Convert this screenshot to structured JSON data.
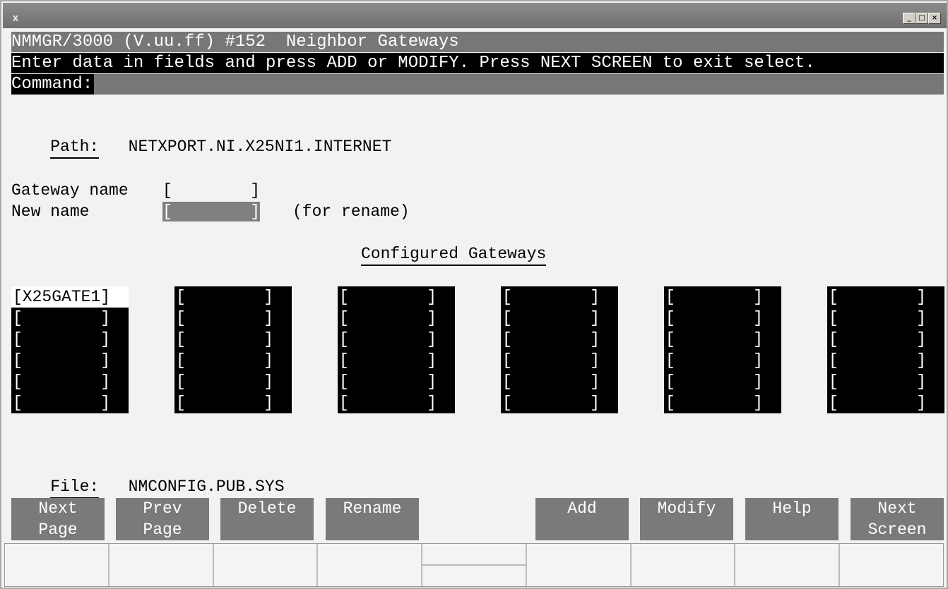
{
  "window": {
    "icon": "X",
    "buttons": [
      "_",
      "□",
      "×"
    ]
  },
  "header": {
    "title": "NMMGR/3000 (V.uu.ff) #152  Neighbor Gateways",
    "instructions": "Enter data in fields and press ADD or MODIFY. Press NEXT SCREEN to exit select.",
    "command_label": "Command:",
    "command_value": ""
  },
  "path": {
    "label": "Path:",
    "value": "NETXPORT.NI.X25NI1.INTERNET"
  },
  "form": {
    "gateway_name_label": "Gateway name",
    "gateway_name_value": "[        ]",
    "new_name_label": "New name",
    "new_name_value": "[        ]",
    "new_name_hint": "(for rename)"
  },
  "configured": {
    "heading": "Configured Gateways",
    "columns": [
      [
        "[X25GATE1]",
        "[        ]",
        "[        ]",
        "[        ]",
        "[        ]",
        "[        ]"
      ],
      [
        "[        ]",
        "[        ]",
        "[        ]",
        "[        ]",
        "[        ]",
        "[        ]"
      ],
      [
        "[        ]",
        "[        ]",
        "[        ]",
        "[        ]",
        "[        ]",
        "[        ]"
      ],
      [
        "[        ]",
        "[        ]",
        "[        ]",
        "[        ]",
        "[        ]",
        "[        ]"
      ],
      [
        "[        ]",
        "[        ]",
        "[        ]",
        "[        ]",
        "[        ]",
        "[        ]"
      ],
      [
        "[        ]",
        "[        ]",
        "[        ]",
        "[        ]",
        "[        ]",
        "[        ]"
      ]
    ]
  },
  "file": {
    "label": "File:",
    "value": "NMCONFIG.PUB.SYS"
  },
  "function_keys": [
    "Next\nPage",
    "Prev\nPage",
    "Delete",
    "Rename",
    "Add",
    "Modify",
    "Help",
    "Next\nScreen"
  ]
}
